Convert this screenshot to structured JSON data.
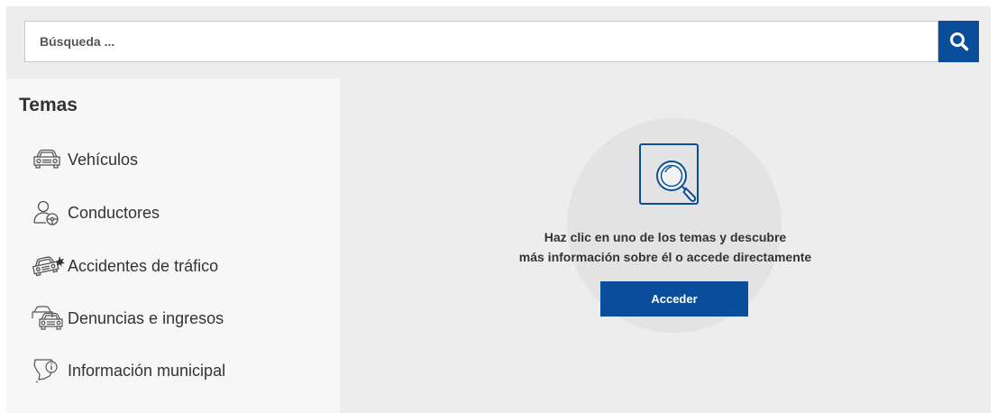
{
  "search": {
    "placeholder": "Búsqueda ...",
    "button_icon": "search-icon"
  },
  "sidebar": {
    "title": "Temas",
    "items": [
      {
        "label": "Vehículos",
        "icon": "car-icon"
      },
      {
        "label": "Conductores",
        "icon": "driver-icon"
      },
      {
        "label": "Accidentes de tráfico",
        "icon": "car-crash-icon"
      },
      {
        "label": "Denuncias e ingresos",
        "icon": "cars-fine-icon"
      },
      {
        "label": "Información municipal",
        "icon": "municipal-map-icon"
      }
    ]
  },
  "main": {
    "illustration": "magnifier-illustration",
    "message_line1": "Haz clic en uno de los temas y descubre",
    "message_line2": "más información sobre él o accede directamente",
    "access_label": "Acceder"
  },
  "colors": {
    "accent": "#0a4e9b",
    "background": "#ededed",
    "sidebar": "#f7f7f7"
  }
}
